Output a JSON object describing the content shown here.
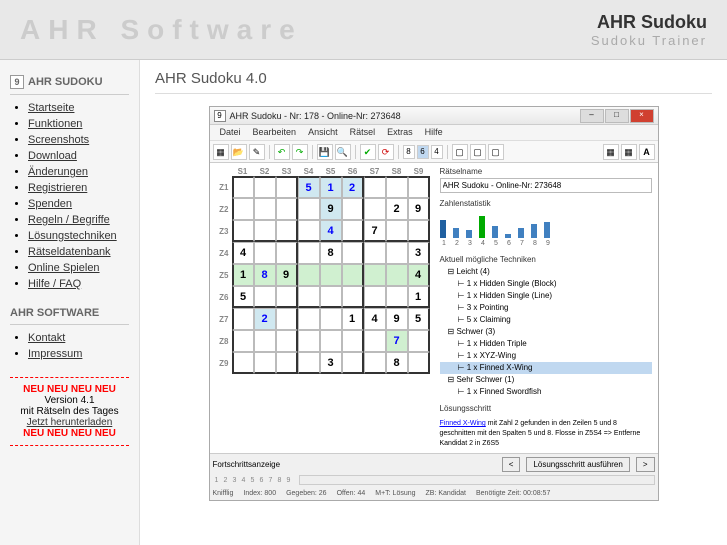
{
  "banner": {
    "left": "AHR Software",
    "title": "AHR Sudoku",
    "sub": "Sudoku Trainer"
  },
  "sidebar": {
    "section1_title": "AHR SUDOKU",
    "items1": [
      "Startseite",
      "Funktionen",
      "Screenshots",
      "Download",
      "Änderungen",
      "Registrieren",
      "Spenden",
      "Regeln / Begriffe",
      "Lösungstechniken",
      "Rätseldatenbank",
      "Online Spielen",
      "Hilfe / FAQ"
    ],
    "section2_title": "AHR SOFTWARE",
    "items2": [
      "Kontakt",
      "Impressum"
    ],
    "promo": {
      "neu": "NEU NEU NEU NEU",
      "ver": "Version 4.1",
      "text": "mit Rätseln des Tages",
      "link": "Jetzt herunterladen"
    }
  },
  "main": {
    "title": "AHR Sudoku 4.0"
  },
  "ss": {
    "title": "AHR Sudoku - Nr: 178 - Online-Nr: 273648",
    "menu": [
      "Datei",
      "Bearbeiten",
      "Ansicht",
      "Rätsel",
      "Extras",
      "Hilfe"
    ],
    "cols": [
      "S1",
      "S2",
      "S3",
      "S4",
      "S5",
      "S6",
      "S7",
      "S8",
      "S9"
    ],
    "rows": [
      "Z1",
      "Z2",
      "Z3",
      "Z4",
      "Z5",
      "Z6",
      "Z7",
      "Z8",
      "Z9"
    ],
    "grid": [
      [
        "",
        "",
        "",
        "5",
        "1",
        "2",
        "",
        "",
        ""
      ],
      [
        "",
        "",
        "",
        "",
        "9",
        "",
        "",
        "2",
        "9"
      ],
      [
        "",
        "",
        "",
        "",
        "4",
        "",
        "7",
        "",
        ""
      ],
      [
        "4",
        "",
        "",
        "",
        "8",
        "",
        "",
        "",
        "3"
      ],
      [
        "1",
        "8",
        "9",
        "",
        "",
        "",
        "",
        "",
        "4"
      ],
      [
        "5",
        "",
        "",
        "",
        "",
        "",
        "",
        "",
        "1"
      ],
      [
        "",
        "2",
        "",
        "",
        "",
        "1",
        "4",
        "9",
        "5"
      ],
      [
        "",
        "",
        "",
        "",
        "",
        "",
        "",
        "7",
        ""
      ],
      [
        "",
        "",
        "",
        "",
        "3",
        "",
        "",
        "8",
        ""
      ]
    ],
    "gridClass": [
      [
        "",
        "",
        "",
        "hl1 solved",
        "hl1 solved",
        "hl1 solved",
        "",
        "",
        ""
      ],
      [
        "",
        "",
        "",
        "",
        "hl1 given",
        "",
        "",
        "given",
        "given"
      ],
      [
        "",
        "",
        "",
        "",
        "hl1 solved",
        "",
        "given",
        "",
        ""
      ],
      [
        "given",
        "",
        "",
        "",
        "given",
        "",
        "",
        "",
        "given"
      ],
      [
        "hl2 given",
        "hl2 solved",
        "hl2 given",
        "hl2",
        "hl2",
        "hl2",
        "hl2",
        "hl2",
        "hl2 given"
      ],
      [
        "given",
        "",
        "",
        "",
        "",
        "",
        "",
        "",
        "given"
      ],
      [
        "",
        "hl1 solved",
        "",
        "",
        "",
        "given",
        "given",
        "given",
        "given"
      ],
      [
        "",
        "",
        "",
        "",
        "",
        "",
        "",
        "hl2 solved",
        ""
      ],
      [
        "",
        "",
        "",
        "",
        "given",
        "",
        "",
        "given",
        ""
      ]
    ],
    "right": {
      "name_label": "Rätselname",
      "name_value": "AHR Sudoku - Online-Nr: 273648",
      "stats_label": "Zahlenstatistik",
      "stats_nums": [
        "1",
        "2",
        "3",
        "4",
        "5",
        "6",
        "7",
        "8",
        "9"
      ],
      "tech_label": "Aktuell mögliche Techniken",
      "tree": {
        "leicht": "Leicht (4)",
        "leicht_items": [
          "1 x Hidden Single (Block)",
          "1 x Hidden Single (Line)",
          "3 x Pointing",
          "5 x Claiming"
        ],
        "schwer": "Schwer (3)",
        "schwer_items": [
          "1 x Hidden Triple",
          "1 x XYZ-Wing",
          "1 x Finned X-Wing"
        ],
        "sschwer": "Sehr Schwer (1)",
        "sschwer_items": [
          "1 x Finned Swordfish"
        ]
      },
      "hint_label": "Lösungsschritt",
      "hint_link": "Finned X-Wing",
      "hint_text": " mit Zahl 2 gefunden in den Zeilen 5 und 8 geschnitten mit den Spalten 5 und 8. Flosse in Z5S4 => Entferne Kandidat 2 in Z6S5"
    },
    "footer": {
      "progress_label": "Fortschrittsanzeige",
      "action": "Lösungsschritt ausführen",
      "status": {
        "knifflig": "Knifflig",
        "index": "Index: 800",
        "gegeben": "Gegeben: 26",
        "offen": "Offen: 44",
        "mt": "M+T: Lösung",
        "zb": "ZB: Kandidat",
        "time": "Benötigte Zeit: 00:08:57"
      },
      "nums": [
        "1",
        "2",
        "3",
        "4",
        "5",
        "6",
        "7",
        "8",
        "9"
      ]
    }
  }
}
